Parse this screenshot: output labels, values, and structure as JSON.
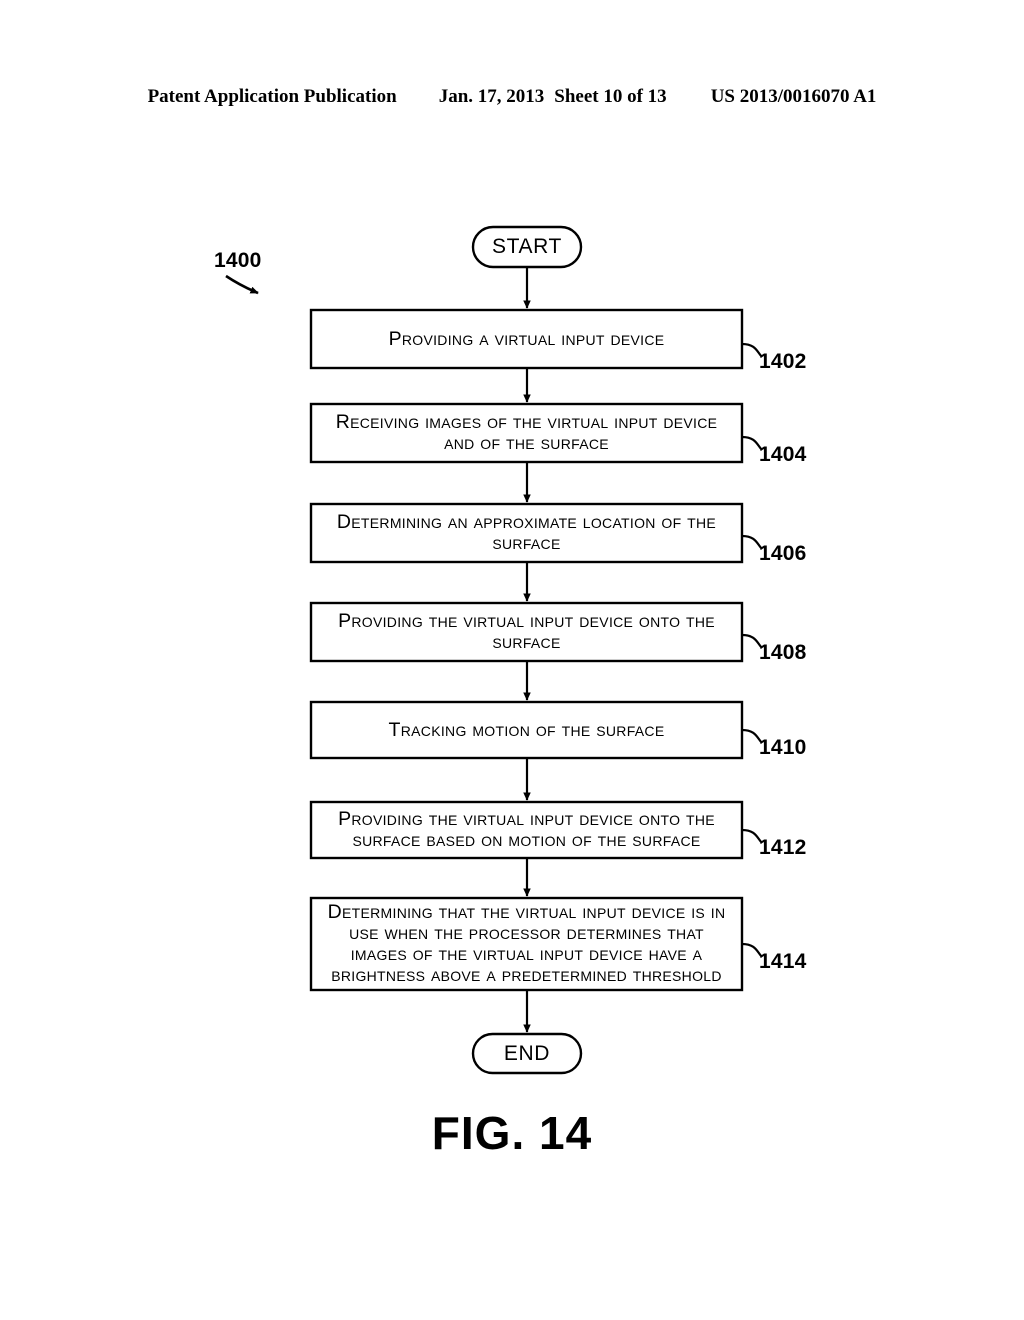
{
  "header": {
    "publication": "Patent Application Publication",
    "date": "Jan. 17, 2013",
    "sheet": "Sheet 10 of 13",
    "patent_number": "US 2013/0016070 A1"
  },
  "figure": {
    "caption": "FIG. 14",
    "diagram_ref": "1400"
  },
  "flowchart": {
    "start_label": "START",
    "end_label": "END",
    "steps": [
      {
        "ref": "1402",
        "text": "Providing a virtual input device"
      },
      {
        "ref": "1404",
        "text": "Receiving images of the virtual input device\nand of the surface"
      },
      {
        "ref": "1406",
        "text": "Determining an approximate location of the\nsurface"
      },
      {
        "ref": "1408",
        "text": "Providing the virtual input device onto the\nsurface"
      },
      {
        "ref": "1410",
        "text": "Tracking motion of the surface"
      },
      {
        "ref": "1412",
        "text": "Providing the virtual input device onto the\nsurface based on motion of the surface"
      },
      {
        "ref": "1414",
        "text": "Determining that the virtual input device is in\nuse when the processor determines that\nimages of the virtual input device have a\nbrightness above a predetermined threshold"
      }
    ]
  },
  "colors": {
    "ink": "#000000",
    "paper": "#ffffff"
  }
}
